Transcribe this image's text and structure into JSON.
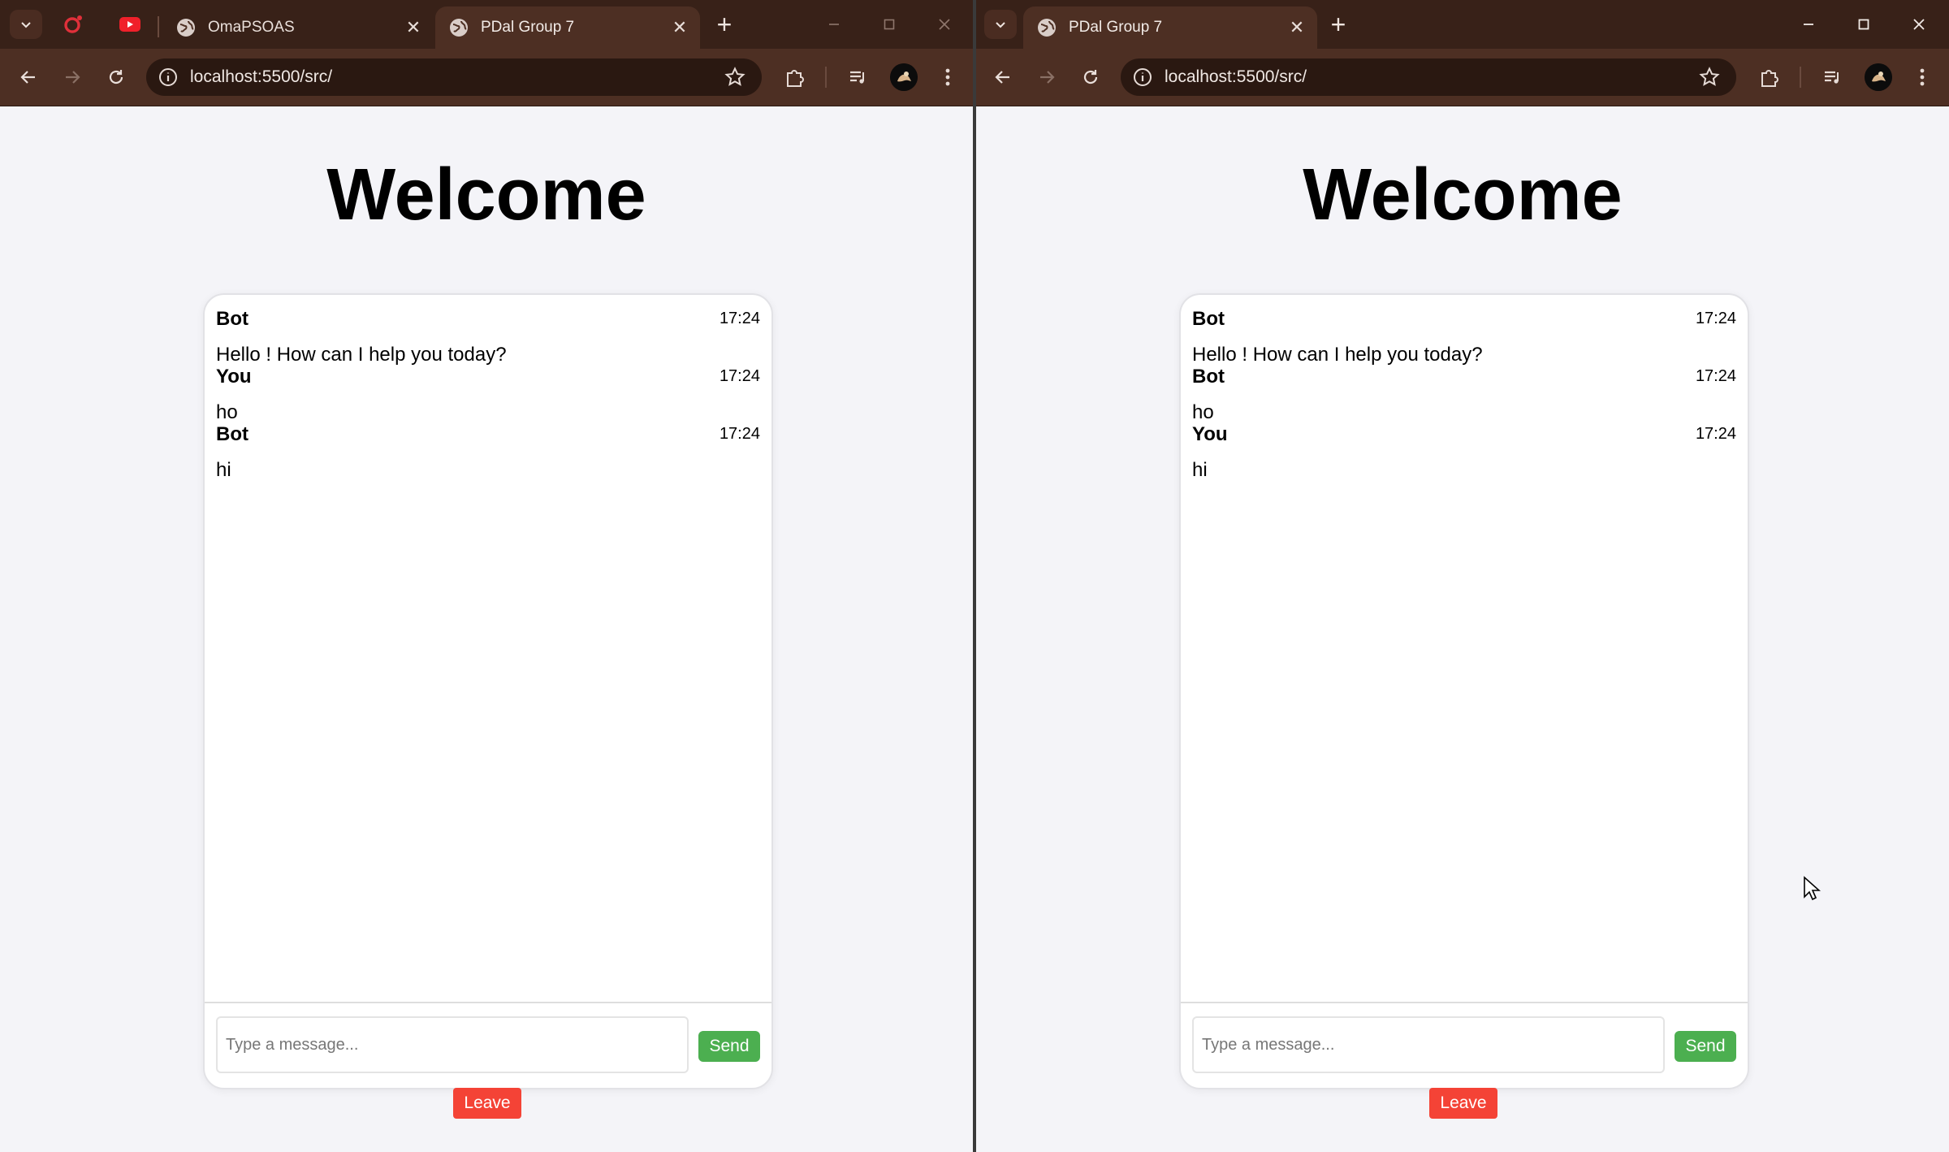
{
  "windows": [
    {
      "tabs": [
        {
          "title": "OmaPSOAS"
        },
        {
          "title": "PDal Group 7"
        }
      ],
      "address": "localhost:5500/src/",
      "page": {
        "heading": "Welcome",
        "messages": [
          {
            "sender": "Bot",
            "time": "17:24",
            "text": "Hello ! How can I help you today?"
          },
          {
            "sender": "You",
            "time": "17:24",
            "text": "ho"
          },
          {
            "sender": "Bot",
            "time": "17:24",
            "text": "hi"
          }
        ],
        "input_placeholder": "Type a message...",
        "input_value": "",
        "send_label": "Send",
        "leave_label": "Leave"
      }
    },
    {
      "tabs": [
        {
          "title": "PDal Group 7"
        }
      ],
      "address": "localhost:5500/src/",
      "page": {
        "heading": "Welcome",
        "messages": [
          {
            "sender": "Bot",
            "time": "17:24",
            "text": "Hello ! How can I help you today?"
          },
          {
            "sender": "Bot",
            "time": "17:24",
            "text": "ho"
          },
          {
            "sender": "You",
            "time": "17:24",
            "text": "hi"
          }
        ],
        "input_placeholder": "Type a message...",
        "input_value": "",
        "send_label": "Send",
        "leave_label": "Leave"
      }
    }
  ],
  "colors": {
    "tabstrip": "#382118",
    "toolbar": "#4d2f23",
    "page_background": "#f4f4f8",
    "send_button": "#4caf50",
    "leave_button": "#f44336"
  }
}
